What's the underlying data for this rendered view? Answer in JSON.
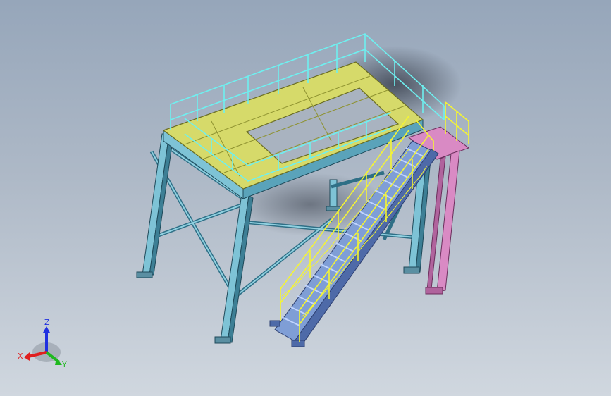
{
  "viewport": {
    "background_top": "#96a6ba",
    "background_bottom": "#d0d7df"
  },
  "colors": {
    "steel": "#7ec3d6",
    "steel_dark": "#2f6f86",
    "deck": "#d6da6a",
    "deck_dark": "#8e9230",
    "railing_cyan": "#6ef0f0",
    "railing_yellow": "#f5f532",
    "landing_pink": "#d98ac4",
    "stair_blue": "#7f9ed6",
    "shadow": "#3a4250"
  },
  "triad": {
    "x_label": "X",
    "y_label": "Y",
    "z_label": "Z",
    "x_color": "#e01f1f",
    "y_color": "#1fb81f",
    "z_color": "#2030e0"
  }
}
